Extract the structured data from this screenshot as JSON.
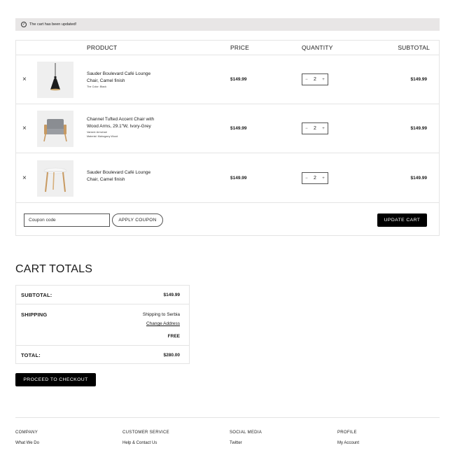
{
  "notice": {
    "text": "The cart has been updated!",
    "icon": "check-circle-icon"
  },
  "cart": {
    "headers": {
      "product": "PRODUCT",
      "price": "PRICE",
      "quantity": "QUANTITY",
      "subtotal": "SUBTOTAL"
    },
    "items": [
      {
        "remove": "×",
        "name_line1": "Sauder Boulevard Café Lounge",
        "name_line2": "Chair, Camel finish",
        "meta1": "The Color: Black",
        "meta2": "",
        "price": "$149.99",
        "qty": "2",
        "minus": "−",
        "plus": "+",
        "subtotal": "$149.99",
        "thumb": "pendant-lamp-image"
      },
      {
        "remove": "×",
        "name_line1": "Channel Tufted Accent Chair with",
        "name_line2": "Wood Arms, 29.1\"W, Ivory-Grey",
        "meta1": "Variant: Armchair",
        "meta2": "Material: Mahogany Wood",
        "price": "$149.99",
        "qty": "2",
        "minus": "−",
        "plus": "+",
        "subtotal": "$149.99",
        "thumb": "armchair-image"
      },
      {
        "remove": "×",
        "name_line1": "Sauder Boulevard Café Lounge",
        "name_line2": "Chair, Camel finish",
        "meta1": "",
        "meta2": "",
        "price": "$149.99",
        "qty": "2",
        "minus": "−",
        "plus": "+",
        "subtotal": "$149.99",
        "thumb": "side-table-image"
      }
    ],
    "coupon_placeholder": "Coupon code",
    "apply_label": "APPLY COUPON",
    "update_label": "UPDATE CART"
  },
  "totals": {
    "title": "CART TOTALS",
    "subtotal_label": "SUBTOTAL:",
    "subtotal_value": "$149.99",
    "shipping_label": "SHIPPING",
    "shipping_to": "Shipping to Serbia",
    "change_address": "Change Address",
    "shipping_value": "FREE",
    "total_label": "TOTAL:",
    "total_value": "$280.00"
  },
  "checkout_label": "PROCEED TO CHECKOUT",
  "footer": {
    "columns": [
      {
        "heading": "COMPANY",
        "link": "What We Do"
      },
      {
        "heading": "CUSTOMER SERVICE",
        "link": "Help & Contact Us"
      },
      {
        "heading": "SOCIAL MEDIA",
        "link": "Twitter"
      },
      {
        "heading": "PROFILE",
        "link": "My Account"
      }
    ]
  }
}
